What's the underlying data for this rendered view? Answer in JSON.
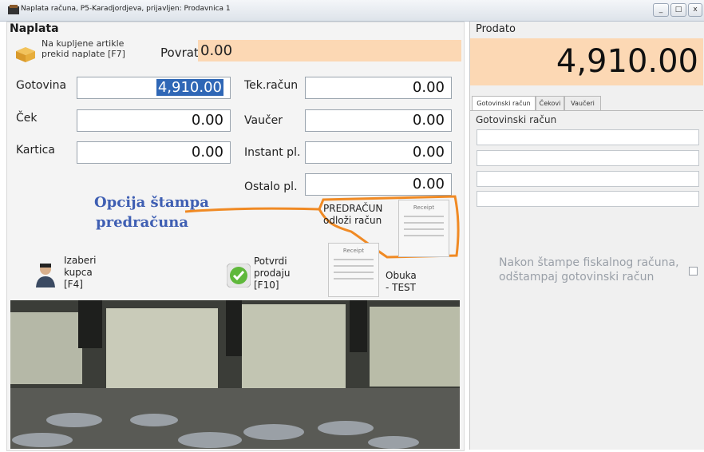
{
  "window": {
    "title": "Naplata računa, P5-Karadjordjeva, prijavljen: Prodavnica 1",
    "min_label": "_",
    "max_label": "□",
    "close_label": "x"
  },
  "payment": {
    "section_title": "Naplata",
    "cancel_label": "Na kupljene artikle prekid naplate [F7]",
    "return_label": "Povrat",
    "return_value": "0.00",
    "fields": [
      {
        "label": "Gotovina",
        "value": "4,910.00"
      },
      {
        "label": "Ček",
        "value": "0.00"
      },
      {
        "label": "Kartica",
        "value": "0.00"
      },
      {
        "label": "Tek.račun",
        "value": "0.00"
      },
      {
        "label": "Vaučer",
        "value": "0.00"
      },
      {
        "label": "Instant pl.",
        "value": "0.00"
      },
      {
        "label": "Ostalo pl.",
        "value": "0.00"
      }
    ]
  },
  "annotation": {
    "line1": "Opcija štampa",
    "line2": "predračuna",
    "color": "#f08a24"
  },
  "actions": {
    "proforma_line1": "PREDRAČUN",
    "proforma_line2": "odloži račun",
    "receipt_header": "Receipt",
    "choose_customer_line1": "Izaberi",
    "choose_customer_line2": "kupca",
    "choose_customer_line3": "[F4]",
    "confirm_line1": "Potvrdi",
    "confirm_line2": "prodaju",
    "confirm_line3": "[F10]",
    "training_line1": "Obuka",
    "training_line2": "- TEST"
  },
  "sold": {
    "title": "Prodato",
    "total": "4,910.00",
    "tabs": [
      "Gotovinski račun",
      "Čekovi",
      "Vaučeri"
    ],
    "panel_title": "Gotovinski račun",
    "fiscal_note_line1": "Nakon štampe fiskalnog računa,",
    "fiscal_note_line2": "odštampaj gotovinski račun",
    "fiscal_checked": false
  },
  "colors": {
    "accent_orange": "#fcd8b4",
    "selection_blue": "#2f67b6",
    "annotation_blue": "#3f5fb3"
  }
}
